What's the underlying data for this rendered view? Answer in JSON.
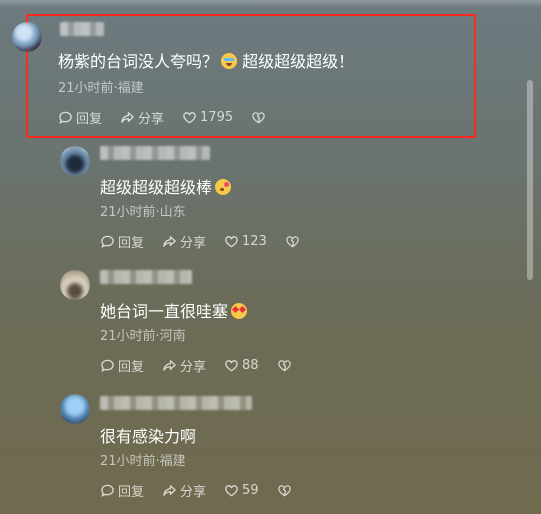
{
  "comments": [
    {
      "text": "杨紫的台词没人夸吗？",
      "text_tail": "超级超级超级！",
      "emoji": "crying-face-emoji",
      "meta": "21小时前·福建",
      "reply": "回复",
      "share": "分享",
      "likes": "1795"
    },
    {
      "text": "超级超级超级棒",
      "emoji": "kiss-face-emoji",
      "meta": "21小时前·山东",
      "reply": "回复",
      "share": "分享",
      "likes": "123"
    },
    {
      "text": "她台词一直很哇塞",
      "emoji": "star-eyes-emoji",
      "meta": "21小时前·河南",
      "reply": "回复",
      "share": "分享",
      "likes": "88"
    },
    {
      "text": "很有感染力啊",
      "meta": "21小时前·福建",
      "reply": "回复",
      "share": "分享",
      "likes": "59"
    }
  ],
  "colors": {
    "highlight_border": "#ff2a1f",
    "text": "#ffffff"
  }
}
